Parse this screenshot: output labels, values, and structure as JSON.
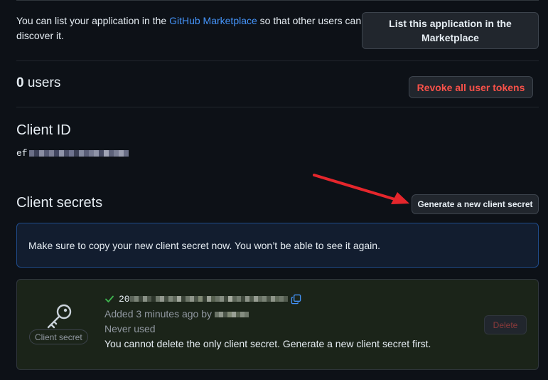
{
  "marketplace": {
    "text_before": "You can list your application in the ",
    "link": "GitHub Marketplace",
    "text_after": " so that other users can discover it.",
    "button": "List this application in the Marketplace"
  },
  "users": {
    "count": "0",
    "label": " users",
    "revoke_button": "Revoke all user tokens"
  },
  "client_id": {
    "heading": "Client ID",
    "value_prefix": "ef"
  },
  "client_secrets": {
    "heading": "Client secrets",
    "generate_button": "Generate a new client secret",
    "flash": "Make sure to copy your new client secret now. You won’t be able to see it again.",
    "secret": {
      "badge": "Client secret",
      "hash_prefix": "20",
      "added": "Added 3 minutes ago by",
      "usage": "Never used",
      "note": "You cannot delete the only client secret. Generate a new client secret first.",
      "delete_button": "Delete"
    }
  },
  "colors": {
    "background": "#0d1117",
    "link": "#4493f8",
    "danger": "#f85149",
    "success": "#3fb950",
    "arrow": "#e5262c"
  }
}
